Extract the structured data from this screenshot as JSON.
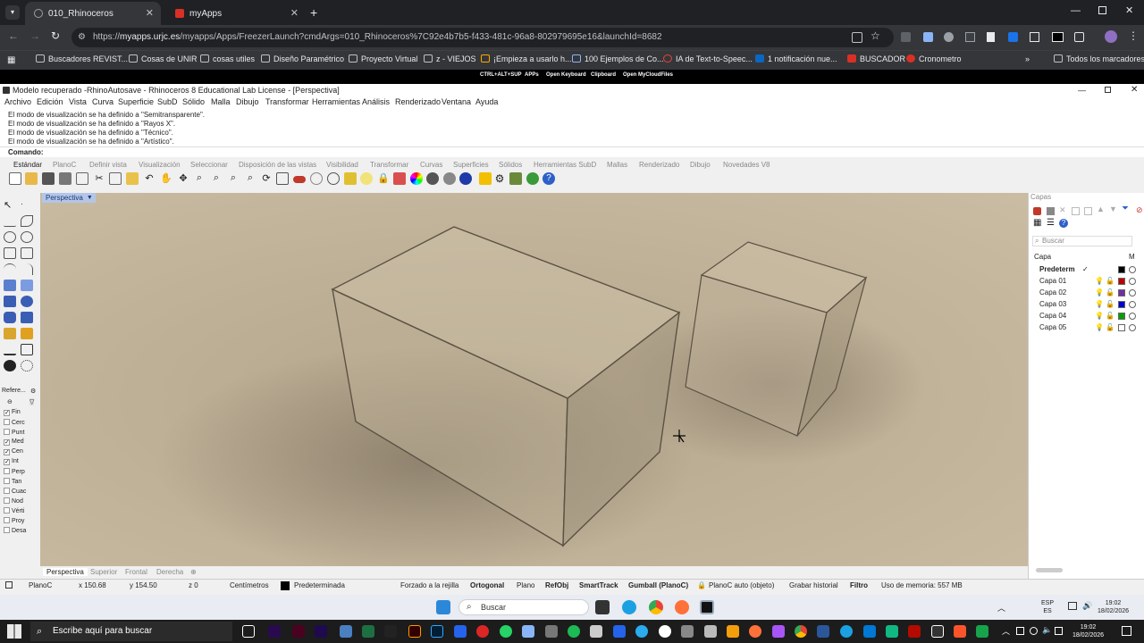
{
  "browser": {
    "tabs": [
      {
        "label": "010_Rhinoceros",
        "active": true
      },
      {
        "label": "myApps",
        "active": false
      }
    ],
    "url_prefix": "https://",
    "url_host": "myapps.urjc.es",
    "url_path": "/myapps/Apps/FreezerLaunch?cmdArgs=010_Rhinoceros%7C92e4b7b5-f433-481c-96a8-802979695e16&launchId=8682",
    "bookmarks": [
      "Buscadores REVIST...",
      "Cosas de UNIR",
      "cosas utiles",
      "Diseño Paramétrico",
      "Proyecto Virtual",
      "z - VIEJOS",
      "¡Empieza a usarlo h...",
      "100 Ejemplos de Co...",
      "IA de Text-to-Speec...",
      "1 notificación nue...",
      "BUSCADOR",
      "Cronometro"
    ],
    "all_bookmarks": "Todos los marcadores"
  },
  "remote_bar": [
    "CTRL+ALT+SUP",
    "APPs",
    "Open Keyboard",
    "Clipboard",
    "Open MyCloudFiles"
  ],
  "rhino": {
    "title": "Modelo recuperado -RhinoAutosave - Rhinoceros 8 Educational Lab License - [Perspectiva]",
    "menu": [
      "Archivo",
      "Edición",
      "Vista",
      "Curva",
      "Superficie",
      "SubD",
      "Sólido",
      "Malla",
      "Dibujo",
      "Transformar",
      "Herramientas",
      "Análisis",
      "Renderizado",
      "Ventana",
      "Ayuda"
    ],
    "history": [
      "El modo de visualización se ha definido a \"Semitransparente\".",
      "El modo de visualización se ha definido a \"Rayos X\".",
      "El modo de visualización se ha definido a \"Técnico\".",
      "El modo de visualización se ha definido a \"Artístico\"."
    ],
    "command_label": "Comando:",
    "toolbar_tabs": [
      "Estándar",
      "PlanoC",
      "Definir vista",
      "Visualización",
      "Seleccionar",
      "Disposición de las vistas",
      "Visibilidad",
      "Transformar",
      "Curvas",
      "Superficies",
      "Sólidos",
      "Herramientas SubD",
      "Mallas",
      "Renderizado",
      "Dibujo",
      "Novedades V8"
    ],
    "viewport_label": "Perspectiva",
    "osnap_header": "Refere...",
    "osnaps": [
      {
        "label": "Fin",
        "checked": true
      },
      {
        "label": "Cerc",
        "checked": false
      },
      {
        "label": "Punt",
        "checked": false
      },
      {
        "label": "Med",
        "checked": true
      },
      {
        "label": "Cen",
        "checked": true
      },
      {
        "label": "Int",
        "checked": true
      },
      {
        "label": "Perp",
        "checked": false
      },
      {
        "label": "Tan",
        "checked": false
      },
      {
        "label": "Cuac",
        "checked": false
      },
      {
        "label": "Nod",
        "checked": false
      },
      {
        "label": "Vérti",
        "checked": false
      },
      {
        "label": "Proy",
        "checked": false
      },
      {
        "label": "Desa",
        "checked": false
      }
    ],
    "view_tabs": [
      "Perspectiva",
      "Superior",
      "Frontal",
      "Derecha"
    ],
    "layers_title": "Capas",
    "layers_search": "Buscar",
    "layers_col": "Capa",
    "layers_col_m": "M",
    "layers": [
      {
        "name": "Predeterm",
        "color": "#000000",
        "current": true
      },
      {
        "name": "Capa 01",
        "color": "#c00000"
      },
      {
        "name": "Capa 02",
        "color": "#7030a0"
      },
      {
        "name": "Capa 03",
        "color": "#0000cc"
      },
      {
        "name": "Capa 04",
        "color": "#00a000"
      },
      {
        "name": "Capa 05",
        "color": "#ffffff"
      }
    ],
    "status": {
      "plane": "PlanoC",
      "x": "x 150.68",
      "y": "y 154.50",
      "z": "z 0",
      "units": "Centímetros",
      "layer": "Predeterminada",
      "grid_snap": "Forzado a la rejilla",
      "ortho": "Ortogonal",
      "planar": "Plano",
      "osnap": "RefObj",
      "smarttrack": "SmartTrack",
      "gumball": "Gumball (PlanoC)",
      "autocplane": "PlanoC auto (objeto)",
      "history": "Grabar historial",
      "filter": "Filtro",
      "memory": "Uso de memoria: 557 MB"
    }
  },
  "inner_taskbar": {
    "search": "Buscar",
    "lang": "ESP",
    "lang2": "ES",
    "time": "19:02",
    "date": "18/02/2026"
  },
  "outer_taskbar": {
    "search": "Escribe aquí para buscar",
    "time": "19:02",
    "date": "18/02/2026"
  }
}
